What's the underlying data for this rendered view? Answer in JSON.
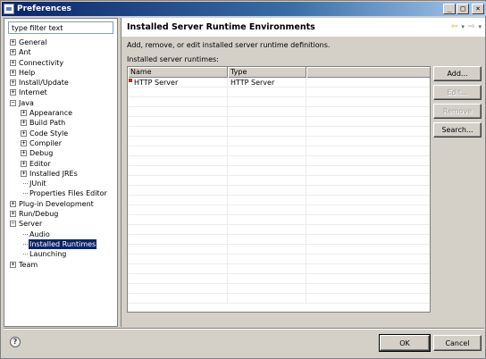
{
  "window": {
    "title": "Preferences"
  },
  "titlebar_buttons": {
    "minimize": "_",
    "maximize": "□",
    "close": "×"
  },
  "filter": {
    "value": "type filter text"
  },
  "tree": [
    {
      "label": "General",
      "level": 0,
      "expander": "+"
    },
    {
      "label": "Ant",
      "level": 0,
      "expander": "+"
    },
    {
      "label": "Connectivity",
      "level": 0,
      "expander": "+"
    },
    {
      "label": "Help",
      "level": 0,
      "expander": "+"
    },
    {
      "label": "Install/Update",
      "level": 0,
      "expander": "+"
    },
    {
      "label": "Internet",
      "level": 0,
      "expander": "+"
    },
    {
      "label": "Java",
      "level": 0,
      "expander": "−"
    },
    {
      "label": "Appearance",
      "level": 1,
      "expander": "+"
    },
    {
      "label": "Build Path",
      "level": 1,
      "expander": "+"
    },
    {
      "label": "Code Style",
      "level": 1,
      "expander": "+"
    },
    {
      "label": "Compiler",
      "level": 1,
      "expander": "+"
    },
    {
      "label": "Debug",
      "level": 1,
      "expander": "+"
    },
    {
      "label": "Editor",
      "level": 1,
      "expander": "+"
    },
    {
      "label": "Installed JREs",
      "level": 1,
      "expander": "+"
    },
    {
      "label": "JUnit",
      "level": 1,
      "expander": ""
    },
    {
      "label": "Properties Files Editor",
      "level": 1,
      "expander": ""
    },
    {
      "label": "Plug-in Development",
      "level": 0,
      "expander": "+"
    },
    {
      "label": "Run/Debug",
      "level": 0,
      "expander": "+"
    },
    {
      "label": "Server",
      "level": 0,
      "expander": "−"
    },
    {
      "label": "Audio",
      "level": 1,
      "expander": ""
    },
    {
      "label": "Installed Runtimes",
      "level": 1,
      "expander": "",
      "selected": true
    },
    {
      "label": "Launching",
      "level": 1,
      "expander": ""
    },
    {
      "label": "Team",
      "level": 0,
      "expander": "+"
    }
  ],
  "page": {
    "title": "Installed Server Runtime Environments",
    "description": "Add, remove, or edit installed server runtime definitions.",
    "list_label": "Installed server runtimes:",
    "columns": [
      "Name",
      "Type",
      ""
    ],
    "rows": [
      {
        "name": "HTTP Server",
        "type": "HTTP Server"
      }
    ]
  },
  "buttons": {
    "add": "Add...",
    "edit": "Edit...",
    "remove": "Remove",
    "search": "Search...",
    "ok": "OK",
    "cancel": "Cancel"
  },
  "icons": {
    "help": "?",
    "nav_back": "⇦",
    "nav_forward": "⇨",
    "nav_menu": "▾"
  },
  "colors": {
    "selection": "#0a246a",
    "titlebar": "#0a246a",
    "server_icon": "#d02020"
  }
}
